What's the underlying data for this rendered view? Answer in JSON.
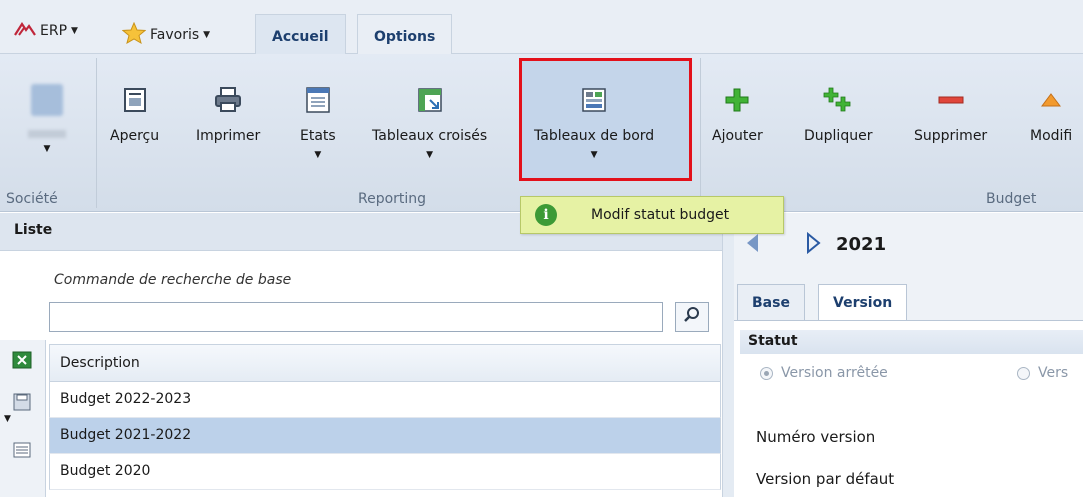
{
  "topbar": {
    "erp_label": "ERP",
    "favoris_label": "Favoris",
    "tabs": [
      {
        "label": "Accueil",
        "active": true
      },
      {
        "label": "Options",
        "active": false
      }
    ]
  },
  "ribbon": {
    "groups": {
      "societe": "Société",
      "reporting": "Reporting",
      "budget": "Budget"
    },
    "buttons": {
      "apercu": "Aperçu",
      "imprimer": "Imprimer",
      "etats": "Etats",
      "tableaux_croises": "Tableaux croisés",
      "tableaux_de_bord": "Tableaux de bord",
      "ajouter": "Ajouter",
      "dupliquer": "Dupliquer",
      "supprimer": "Supprimer",
      "modifier": "Modifi"
    }
  },
  "tooltip": {
    "text": "Modif statut budget"
  },
  "list": {
    "header": "Liste",
    "search_caption": "Commande de recherche de base",
    "search_value": "",
    "column_header": "Description",
    "rows": [
      {
        "description": "Budget 2022-2023",
        "selected": false
      },
      {
        "description": "Budget 2021-2022",
        "selected": true
      },
      {
        "description": "Budget 2020",
        "selected": false
      }
    ]
  },
  "detail": {
    "year": "2021",
    "tabs": [
      {
        "label": "Base",
        "active": false
      },
      {
        "label": "Version",
        "active": true
      }
    ],
    "section_title": "Statut",
    "radio_version_arretee": "Version arrêtée",
    "radio_version_other": "Vers",
    "numero_version_label": "Numéro version",
    "version_defaut_label": "Version par défaut"
  },
  "colors": {
    "highlight_border": "#e3101a",
    "tooltip_bg": "#e6f2a4",
    "selected_row": "#bcd1ea",
    "tab_text": "#1d3f6e"
  }
}
